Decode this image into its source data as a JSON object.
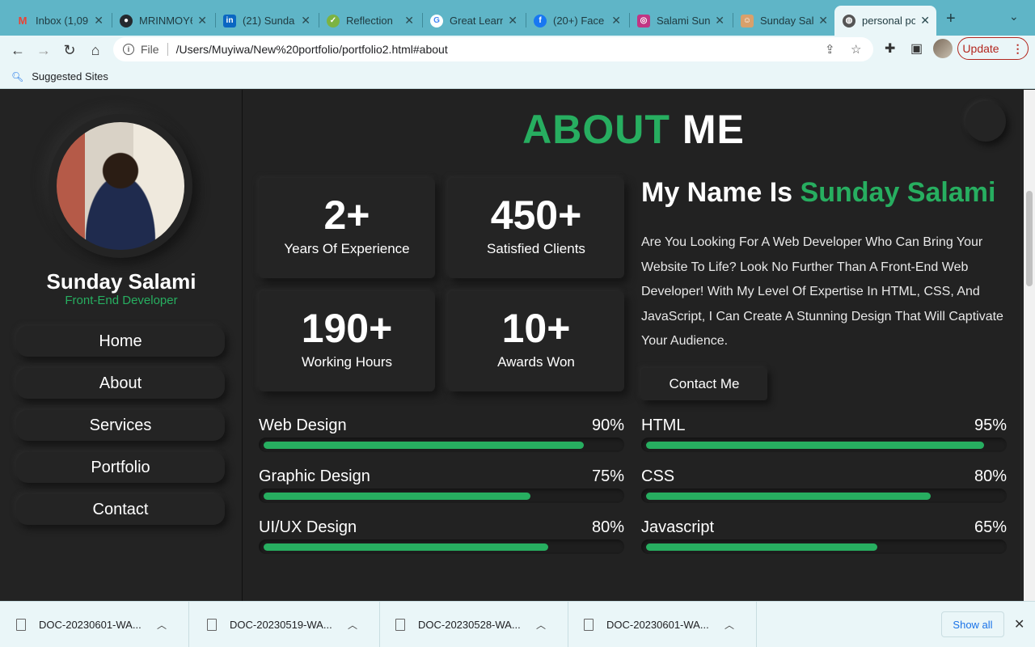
{
  "browser": {
    "tabs": [
      {
        "label": "Inbox (1,09",
        "icon": "gmail-icon",
        "color": "#ea4335",
        "glyph": "M"
      },
      {
        "label": "MRINMOY6",
        "icon": "github-icon",
        "color": "#24292e",
        "glyph": "●"
      },
      {
        "label": "(21) Sunda",
        "icon": "linkedin-icon",
        "color": "#0a66c2",
        "glyph": "in"
      },
      {
        "label": "Reflection",
        "icon": "check-icon",
        "color": "#7cb342",
        "glyph": "✓"
      },
      {
        "label": "Great Learn",
        "icon": "google-icon",
        "color": "#ffffff",
        "glyph": "G"
      },
      {
        "label": "(20+) Face",
        "icon": "facebook-icon",
        "color": "#1877f2",
        "glyph": "f"
      },
      {
        "label": "Salami Sun",
        "icon": "instagram-icon",
        "color": "#c13584",
        "glyph": "◎"
      },
      {
        "label": "Sunday Sal",
        "icon": "portfolio-icon",
        "color": "#d9a06b",
        "glyph": "☺"
      },
      {
        "label": "personal po",
        "icon": "globe-icon",
        "color": "#555555",
        "glyph": "◍",
        "active": true
      }
    ],
    "new_tab": "+",
    "tab_menu": "⌄",
    "nav": {
      "back": "←",
      "forward": "→",
      "reload": "↻",
      "home": "⌂"
    },
    "address": {
      "info": "i",
      "scheme": "File",
      "url": "/Users/Muyiwa/New%20portfolio/portfolio2.html#about"
    },
    "update_label": "Update",
    "update_menu": "⋮",
    "bookmarks": {
      "icon": "search-icon",
      "label": "Suggested Sites"
    }
  },
  "sidebar": {
    "name": "Sunday Salami",
    "role": "Front-End Developer",
    "nav": [
      "Home",
      "About",
      "Services",
      "Portfolio",
      "Contact"
    ]
  },
  "about": {
    "title_green": "ABOUT",
    "title_white": "ME",
    "stats": [
      {
        "number": "2+",
        "label": "Years Of Experience"
      },
      {
        "number": "450+",
        "label": "Satisfied Clients"
      },
      {
        "number": "190+",
        "label": "Working Hours"
      },
      {
        "number": "10+",
        "label": "Awards Won"
      }
    ],
    "heading_white": "My Name Is",
    "heading_green": "Sunday Salami",
    "bio": "Are You Looking For A Web Developer Who Can Bring Your Website To Life? Look No Further Than A Front-End Web Developer! With My Level Of Expertise In HTML, CSS, And JavaScript, I Can Create A Stunning Design That Will Captivate Your Audience.",
    "contact_label": "Contact Me"
  },
  "skills": {
    "left": [
      {
        "name": "Web Design",
        "percent": "90%",
        "fill": 0.9
      },
      {
        "name": "Graphic Design",
        "percent": "75%",
        "fill": 0.75
      },
      {
        "name": "UI/UX Design",
        "percent": "80%",
        "fill": 0.8
      }
    ],
    "right": [
      {
        "name": "HTML",
        "percent": "95%",
        "fill": 0.95
      },
      {
        "name": "CSS",
        "percent": "80%",
        "fill": 0.8
      },
      {
        "name": "Javascript",
        "percent": "65%",
        "fill": 0.65
      }
    ]
  },
  "downloads": {
    "files": [
      "DOC-20230601-WA...",
      "DOC-20230519-WA...",
      "DOC-20230528-WA...",
      "DOC-20230601-WA..."
    ],
    "show_all": "Show all",
    "close": "✕"
  },
  "colors": {
    "accent": "#27ae60",
    "background": "#222222",
    "chrome": "#5fb5c7"
  }
}
